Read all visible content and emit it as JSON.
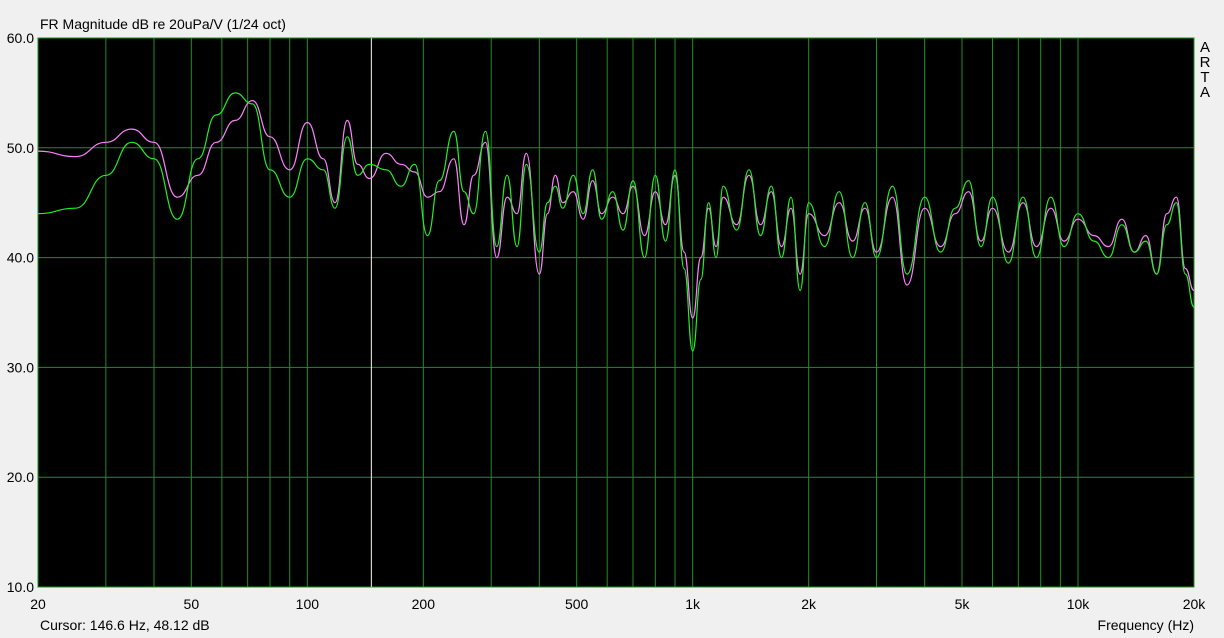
{
  "window": {
    "title": "FR Magnitude dB re 20uPa/V (1/24 oct)",
    "cursor_readout": "Cursor: 146.6 Hz, 48.12 dB",
    "brand_letters": [
      "A",
      "R",
      "T",
      "A"
    ]
  },
  "colors": {
    "plot_bg": "#000000",
    "grid": "#1f8f1f",
    "cursor_line": "#f8f8e8",
    "series_1": "#ff80ff",
    "series_2": "#22ee22"
  },
  "chart_data": {
    "type": "line",
    "title": "FR Magnitude dB re 20uPa/V (1/24 oct)",
    "xlabel": "Frequency (Hz)",
    "ylabel": "",
    "x_scale": "log",
    "xlim": [
      20,
      20000
    ],
    "ylim": [
      10,
      60
    ],
    "grid": true,
    "x_ticks": [
      20,
      50,
      100,
      200,
      500,
      1000,
      2000,
      5000,
      10000,
      20000
    ],
    "x_tick_labels": [
      "20",
      "50",
      "100",
      "200",
      "500",
      "1k",
      "2k",
      "5k",
      "10k",
      "20k"
    ],
    "y_ticks": [
      10,
      20,
      30,
      40,
      50,
      60
    ],
    "y_tick_labels": [
      "10.0",
      "20.0",
      "30.0",
      "40.0",
      "50.0",
      "60.0"
    ],
    "cursor": {
      "x": 146.6,
      "y": 48.12
    },
    "series": [
      {
        "color": "#ff80ff",
        "x": [
          20,
          25,
          30,
          35,
          40,
          46,
          52,
          58,
          65,
          72,
          80,
          90,
          100,
          110,
          118,
          127,
          135,
          145,
          160,
          175,
          190,
          205,
          220,
          240,
          255,
          270,
          290,
          310,
          330,
          350,
          370,
          400,
          420,
          440,
          460,
          490,
          520,
          550,
          580,
          620,
          660,
          700,
          750,
          800,
          850,
          900,
          950,
          1000,
          1050,
          1100,
          1150,
          1200,
          1300,
          1400,
          1500,
          1600,
          1700,
          1800,
          1900,
          2000,
          2200,
          2400,
          2600,
          2800,
          3000,
          3300,
          3600,
          4000,
          4400,
          4800,
          5200,
          5600,
          6000,
          6600,
          7200,
          7800,
          8500,
          9200,
          10000,
          11000,
          12000,
          13000,
          14000,
          15000,
          16000,
          17000,
          18000,
          19000,
          20000
        ],
        "y": [
          49.7,
          49.2,
          50.5,
          51.7,
          50.5,
          45.5,
          47.5,
          50.5,
          52.5,
          54.3,
          51.0,
          48.0,
          52.3,
          49.0,
          45.0,
          52.5,
          48.5,
          47.2,
          49.5,
          48.5,
          47.8,
          45.5,
          46.0,
          49.0,
          43.0,
          47.5,
          50.5,
          40.0,
          45.5,
          44.0,
          49.5,
          38.5,
          44.0,
          47.5,
          45.0,
          46.0,
          43.5,
          47.0,
          44.0,
          45.5,
          44.0,
          46.5,
          42.0,
          46.0,
          43.0,
          47.5,
          40.5,
          34.5,
          40.0,
          44.5,
          41.0,
          45.5,
          43.0,
          47.5,
          43.0,
          46.0,
          41.0,
          44.5,
          38.5,
          44.0,
          42.0,
          45.0,
          41.5,
          44.5,
          40.5,
          45.5,
          37.5,
          44.5,
          41.0,
          44.0,
          46.0,
          41.5,
          44.5,
          40.5,
          45.0,
          41.0,
          44.5,
          41.5,
          43.5,
          42.0,
          41.0,
          43.5,
          40.5,
          42.0,
          38.5,
          44.0,
          45.5,
          39.0,
          37.0
        ]
      },
      {
        "color": "#22ee22",
        "x": [
          20,
          25,
          30,
          35,
          40,
          46,
          52,
          58,
          65,
          72,
          80,
          90,
          100,
          110,
          118,
          127,
          135,
          145,
          160,
          175,
          190,
          205,
          220,
          240,
          255,
          270,
          290,
          310,
          330,
          350,
          370,
          400,
          420,
          440,
          460,
          490,
          520,
          550,
          580,
          620,
          660,
          700,
          750,
          800,
          850,
          900,
          950,
          1000,
          1050,
          1100,
          1150,
          1200,
          1300,
          1400,
          1500,
          1600,
          1700,
          1800,
          1900,
          2000,
          2200,
          2400,
          2600,
          2800,
          3000,
          3300,
          3600,
          4000,
          4400,
          4800,
          5200,
          5600,
          6000,
          6600,
          7200,
          7800,
          8500,
          9200,
          10000,
          11000,
          12000,
          13000,
          14000,
          15000,
          16000,
          17000,
          18000,
          19000,
          20000
        ],
        "y": [
          44.0,
          44.5,
          47.5,
          50.5,
          49.0,
          43.5,
          49.0,
          53.0,
          55.0,
          54.0,
          48.0,
          45.5,
          49.0,
          48.0,
          44.5,
          51.0,
          47.5,
          48.5,
          48.0,
          46.5,
          48.5,
          42.0,
          47.0,
          51.5,
          46.0,
          44.0,
          51.5,
          41.0,
          47.5,
          41.0,
          48.5,
          40.5,
          45.0,
          46.5,
          44.5,
          47.5,
          44.0,
          48.0,
          43.5,
          46.0,
          42.5,
          47.0,
          40.0,
          47.5,
          41.5,
          48.0,
          39.0,
          31.5,
          38.0,
          45.0,
          40.0,
          46.5,
          42.5,
          48.0,
          42.0,
          46.5,
          40.0,
          45.5,
          37.0,
          45.0,
          41.0,
          46.0,
          40.0,
          45.0,
          40.0,
          46.5,
          38.5,
          45.5,
          40.5,
          44.5,
          47.0,
          41.0,
          45.5,
          39.5,
          45.5,
          40.0,
          45.5,
          41.0,
          44.0,
          41.5,
          40.0,
          43.0,
          40.5,
          41.5,
          38.5,
          43.0,
          45.0,
          38.5,
          35.5
        ]
      }
    ]
  }
}
